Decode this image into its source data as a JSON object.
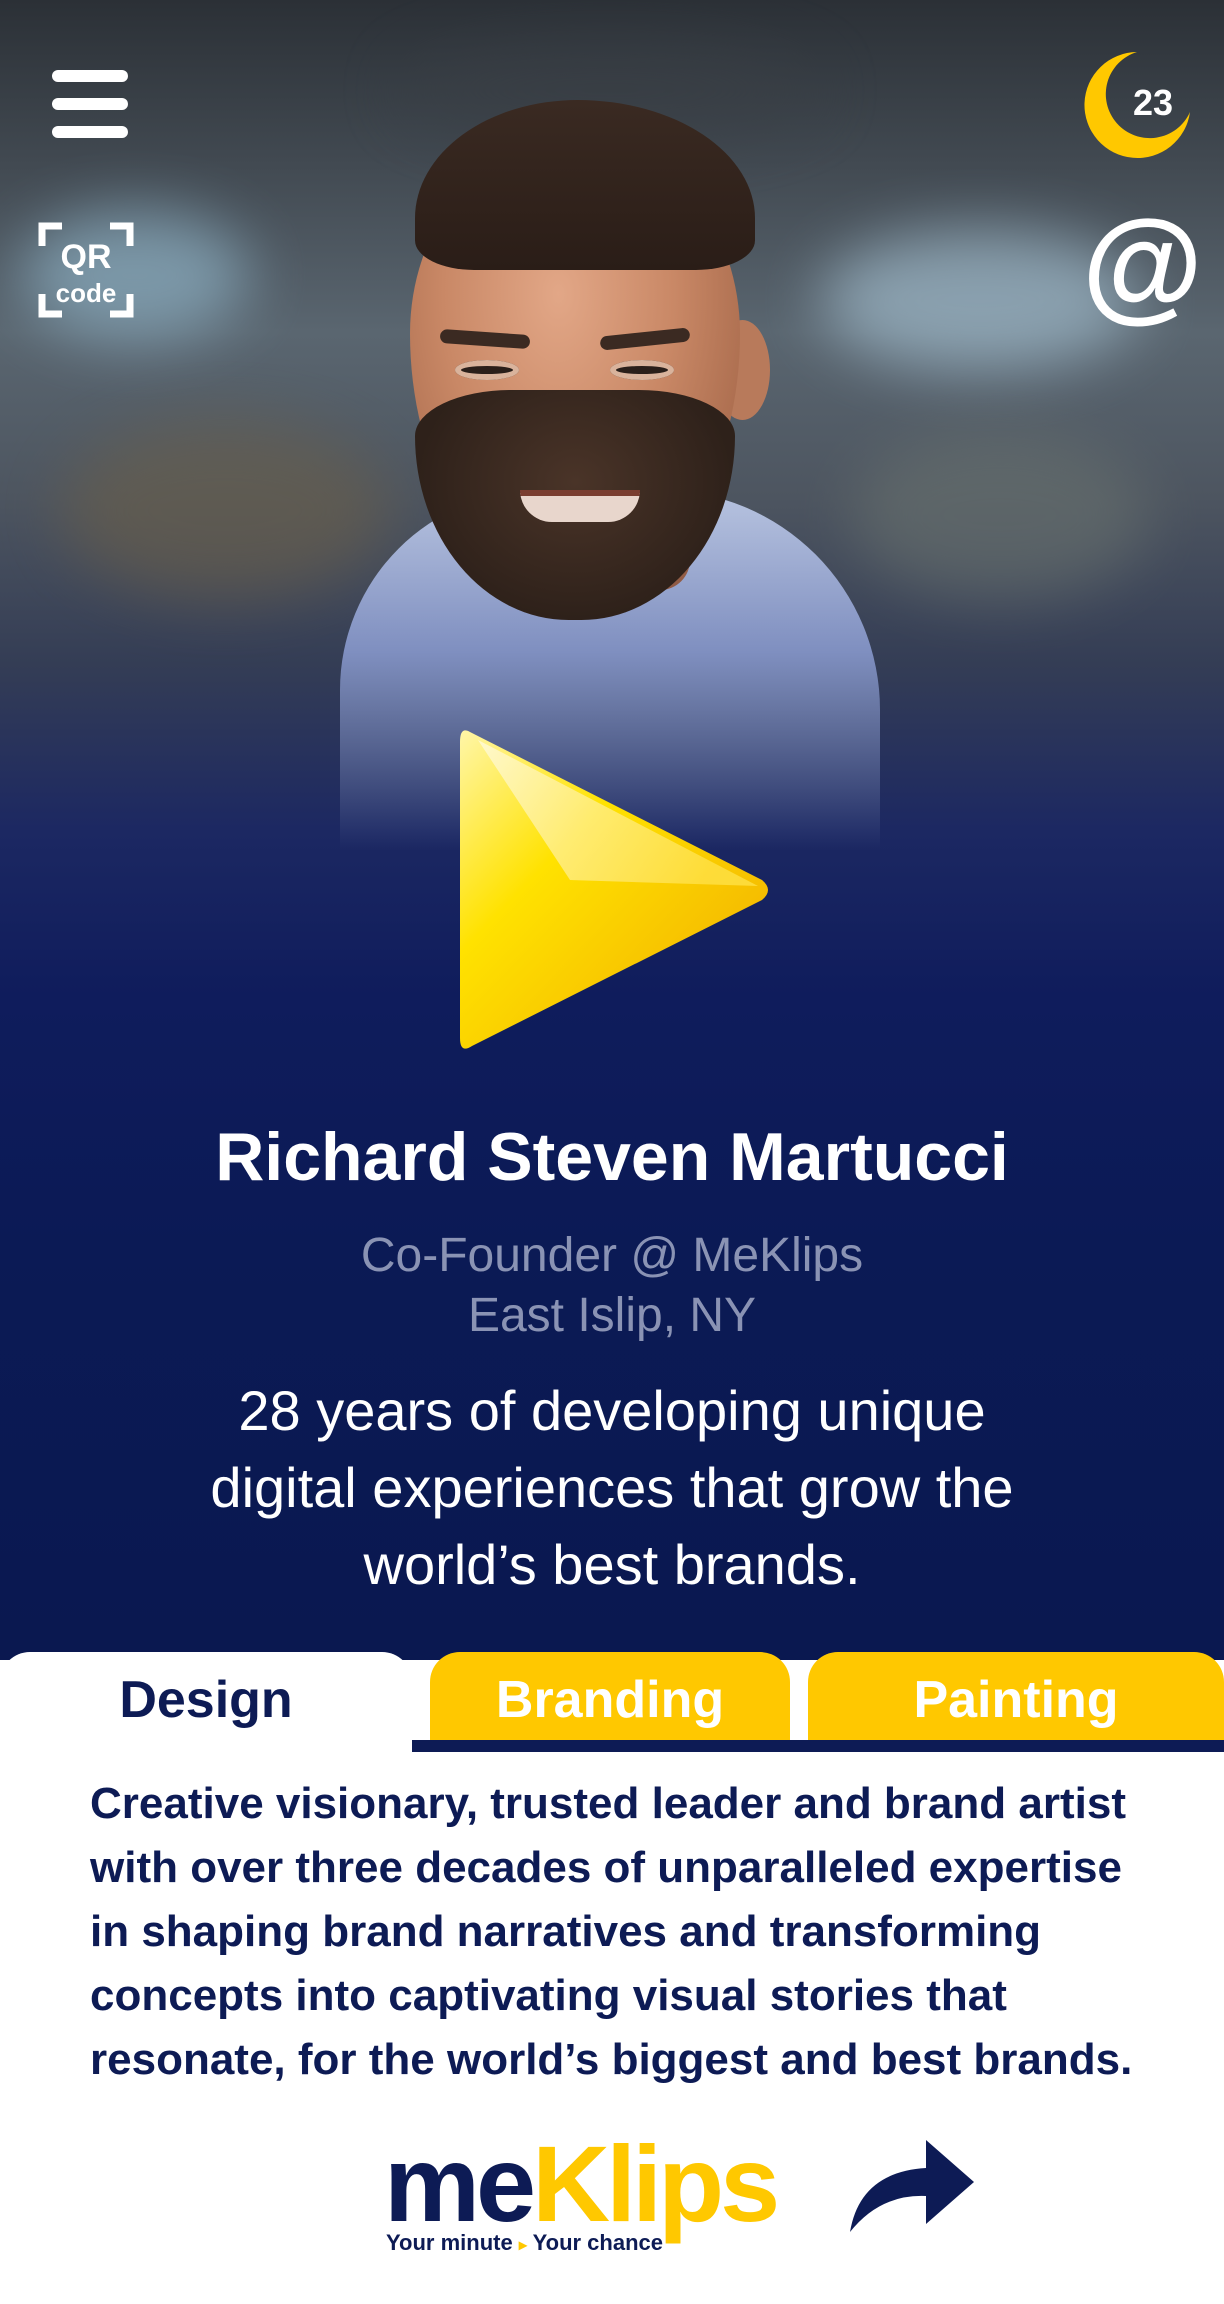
{
  "header": {
    "menu_icon": "hamburger-menu-icon",
    "qr_icon": "qr-code-icon",
    "qr_label_top": "QR",
    "qr_label_bottom": "code",
    "badge_icon": "moon-badge-icon",
    "badge_count": "23",
    "contact_icon": "at-sign-icon",
    "contact_symbol": "@"
  },
  "hero": {
    "play_icon": "play-icon",
    "name": "Richard Steven Martucci",
    "role": "Co-Founder @ MeKlips",
    "location": "East Islip, NY",
    "tagline": "28 years of developing unique digital experiences that grow the world’s best brands."
  },
  "tabs": {
    "items": [
      {
        "label": "Design",
        "active": true
      },
      {
        "label": "Branding",
        "active": false
      },
      {
        "label": "Painting",
        "active": false
      }
    ]
  },
  "content": {
    "description": "Creative visionary, trusted leader and brand artist with over three decades of unparalleled expertise in shaping brand narratives and transforming concepts into captivating visual stories that resonate, for the world’s biggest and best brands."
  },
  "footer": {
    "logo_me": "me",
    "logo_klips": "Klips",
    "logo_tagline_a": "Your minute",
    "logo_tagline_b": "Your chance",
    "share_icon": "share-arrow-icon"
  },
  "colors": {
    "navy": "#0d1b55",
    "accent_yellow": "#ffc800",
    "muted_text": "#8a93b4",
    "white": "#ffffff"
  }
}
